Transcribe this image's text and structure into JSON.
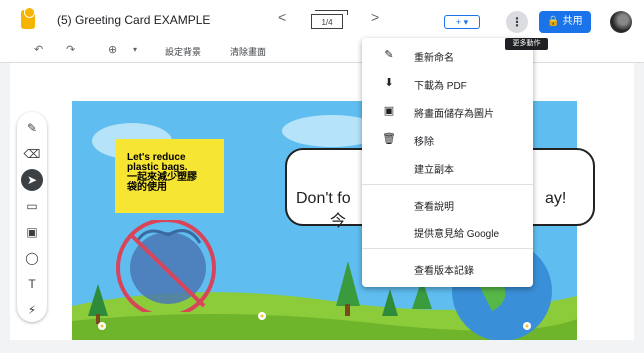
{
  "app": {
    "title": "(5) Greeting Card EXAMPLE"
  },
  "nav": {
    "prev": "<",
    "page_indicator": "1/4",
    "next": ">"
  },
  "header": {
    "add_label": "+ ▾",
    "more_label": "⋮",
    "share_label": "🔒 共用",
    "tooltip": "更多動作"
  },
  "toolbar": {
    "undo": "↶",
    "redo": "↷",
    "zoom": "⊕",
    "zoom_dropdown": "▾",
    "set_background": "設定背景",
    "clear_page": "清除畫面"
  },
  "tools": {
    "pen": "✎",
    "eraser": "⌫",
    "select": "➤",
    "sticky": "▭",
    "image": "▣",
    "shape": "◯",
    "textbox": "T",
    "laser": "⚡"
  },
  "canvas": {
    "sticky_text": "Let's reduce\nplastic bags.\n一起來減少塑膠\n袋的使用",
    "bubble_text_left": "Don't fo",
    "bubble_text_left2": "今",
    "bubble_text_right": "ay!"
  },
  "menu": {
    "items": [
      {
        "label": "重新命名",
        "icon": "✎"
      },
      {
        "label": "下載為 PDF",
        "icon": "⬇"
      },
      {
        "label": "將畫面儲存為圖片",
        "icon": "▣"
      },
      {
        "label": "移除",
        "icon": "🗑"
      },
      {
        "label": "建立副本",
        "icon": ""
      },
      {
        "label": "查看說明",
        "icon": ""
      },
      {
        "label": "提供意見給 Google",
        "icon": ""
      },
      {
        "label": "查看版本記錄",
        "icon": ""
      }
    ]
  },
  "colors": {
    "accent": "#1a73e8",
    "sticky": "#f7e533",
    "sky": "#5fbdf0",
    "grass": "#8ccc3a"
  }
}
